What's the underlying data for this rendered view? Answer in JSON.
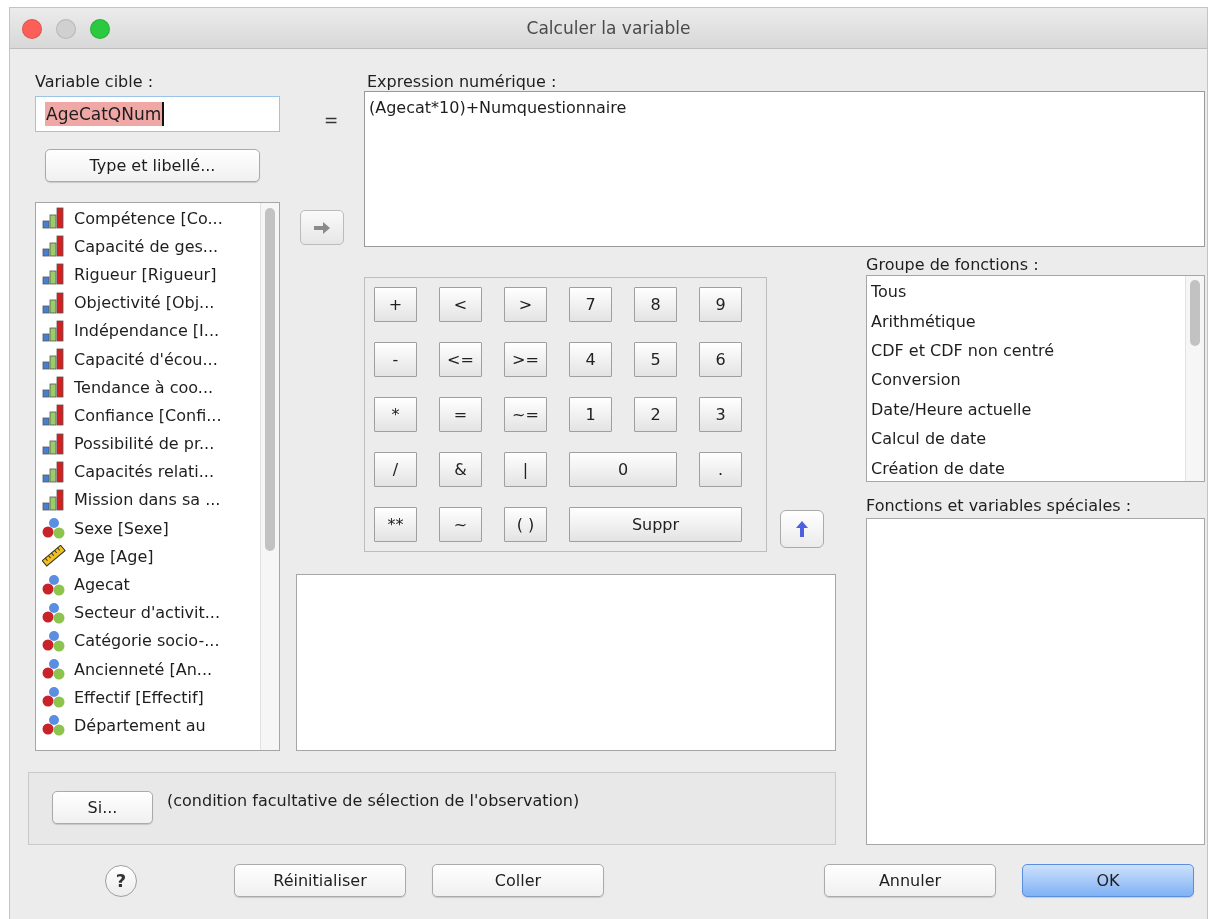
{
  "window": {
    "title": "Calculer la variable"
  },
  "target": {
    "label": "Variable cible :",
    "value": "AgeCatQNum",
    "selected": true
  },
  "type_button": "Type et libellé...",
  "equals": "=",
  "variables": [
    {
      "name": "Compétence [Co...",
      "kind": "ordinal"
    },
    {
      "name": "Capacité de ges...",
      "kind": "ordinal"
    },
    {
      "name": "Rigueur [Rigueur]",
      "kind": "ordinal"
    },
    {
      "name": "Objectivité [Obj...",
      "kind": "ordinal"
    },
    {
      "name": "Indépendance [I...",
      "kind": "ordinal"
    },
    {
      "name": "Capacité d'écou...",
      "kind": "ordinal"
    },
    {
      "name": "Tendance à coo...",
      "kind": "ordinal"
    },
    {
      "name": "Confiance [Confi...",
      "kind": "ordinal"
    },
    {
      "name": "Possibilité de pr...",
      "kind": "ordinal"
    },
    {
      "name": "Capacités relati...",
      "kind": "ordinal"
    },
    {
      "name": "Mission dans sa ...",
      "kind": "ordinal"
    },
    {
      "name": "Sexe [Sexe]",
      "kind": "nominal"
    },
    {
      "name": "Age [Age]",
      "kind": "scale"
    },
    {
      "name": "Agecat",
      "kind": "nominal"
    },
    {
      "name": "Secteur d'activit...",
      "kind": "nominal"
    },
    {
      "name": "Catégorie socio-...",
      "kind": "nominal"
    },
    {
      "name": "Ancienneté  [An...",
      "kind": "nominal"
    },
    {
      "name": "Effectif [Effectif]",
      "kind": "nominal"
    },
    {
      "name": "Département au",
      "kind": "nominal"
    }
  ],
  "expression": {
    "label": "Expression numérique :",
    "value": "(Agecat*10)+Numquestionnaire"
  },
  "keypad": [
    [
      {
        "label": "+",
        "kind": "key"
      },
      {
        "label": "<",
        "kind": "key"
      },
      {
        "label": ">",
        "kind": "key"
      },
      {
        "label": "7",
        "kind": "key"
      },
      {
        "label": "8",
        "kind": "key"
      },
      {
        "label": "9",
        "kind": "key"
      }
    ],
    [
      {
        "label": "-",
        "kind": "key"
      },
      {
        "label": "<=",
        "kind": "key"
      },
      {
        "label": ">=",
        "kind": "key"
      },
      {
        "label": "4",
        "kind": "key"
      },
      {
        "label": "5",
        "kind": "key"
      },
      {
        "label": "6",
        "kind": "key"
      }
    ],
    [
      {
        "label": "*",
        "kind": "key"
      },
      {
        "label": "=",
        "kind": "key"
      },
      {
        "label": "~=",
        "kind": "key"
      },
      {
        "label": "1",
        "kind": "key"
      },
      {
        "label": "2",
        "kind": "key"
      },
      {
        "label": "3",
        "kind": "key"
      }
    ],
    [
      {
        "label": "/",
        "kind": "key"
      },
      {
        "label": "&",
        "kind": "key"
      },
      {
        "label": "|",
        "kind": "key"
      },
      {
        "label": "0",
        "kind": "double"
      },
      {
        "label": ".",
        "kind": "key"
      }
    ],
    [
      {
        "label": "**",
        "kind": "key"
      },
      {
        "label": "~",
        "kind": "key"
      },
      {
        "label": "( )",
        "kind": "key"
      },
      {
        "label": "Suppr",
        "kind": "triple"
      }
    ]
  ],
  "function_groups": {
    "label": "Groupe de fonctions :",
    "items": [
      "Tous",
      "Arithmétique",
      "CDF et CDF non centré",
      "Conversion",
      "Date/Heure actuelle",
      "Calcul de date",
      "Création de date"
    ]
  },
  "special_functions": {
    "label": "Fonctions et variables spéciales :"
  },
  "condition": {
    "button": "Si...",
    "text": "(condition facultative de sélection de l'observation)"
  },
  "buttons": [
    {
      "label": "Réinitialiser",
      "default": false
    },
    {
      "label": "Coller",
      "default": false
    },
    {
      "label": "Annuler",
      "default": false
    },
    {
      "label": "OK",
      "default": true
    }
  ],
  "help": "?"
}
